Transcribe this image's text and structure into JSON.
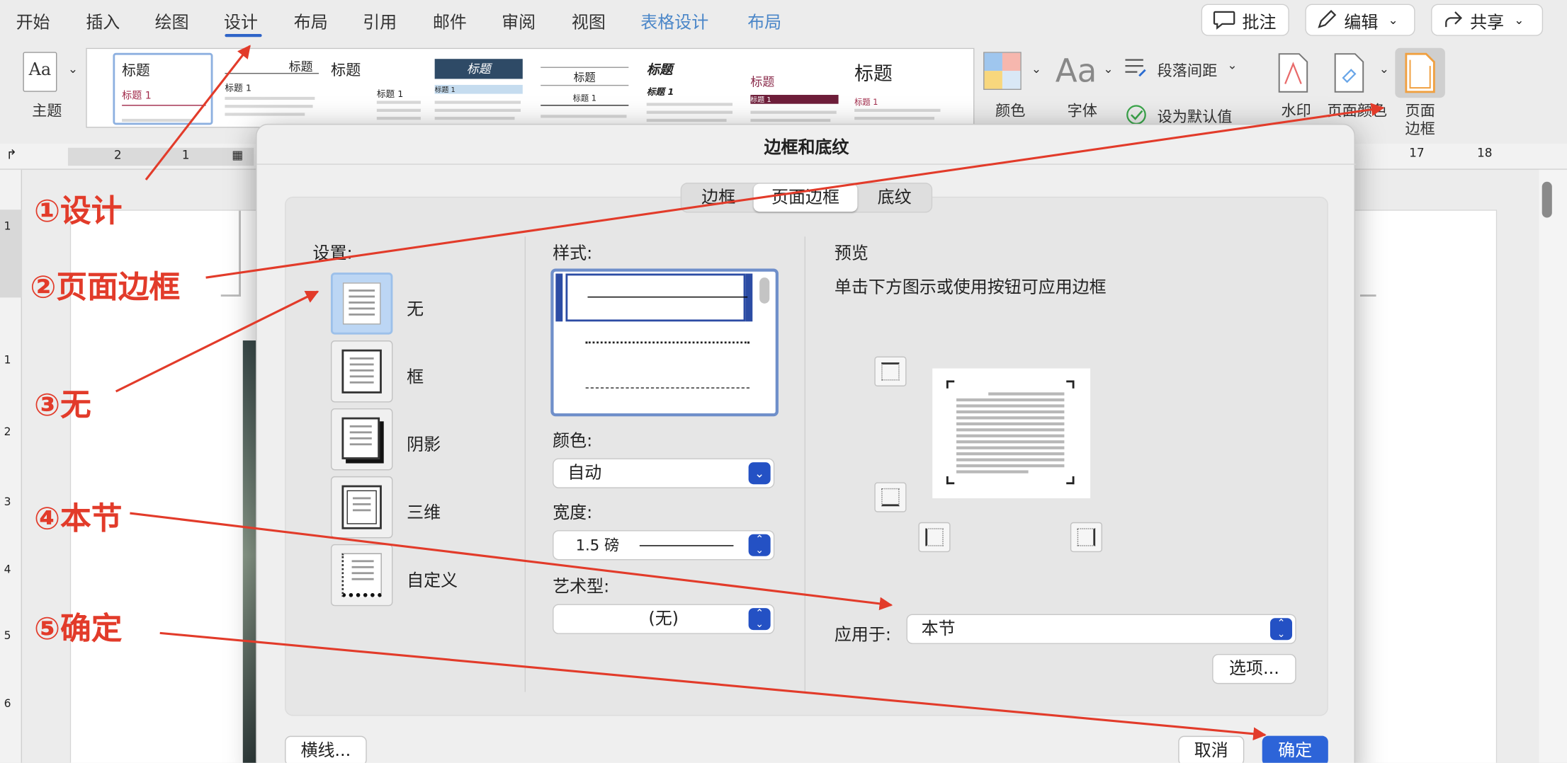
{
  "menubar": {
    "items": [
      "开始",
      "插入",
      "绘图",
      "设计",
      "布局",
      "引用",
      "邮件",
      "审阅",
      "视图",
      "表格设计",
      "布局"
    ],
    "comment_label": "批注",
    "edit_label": "编辑",
    "share_label": "共享"
  },
  "ribbon": {
    "theme_icon_text": "Aa",
    "theme_label": "主题",
    "gallery": [
      {
        "title": "标题",
        "subtitle": "标题 1"
      },
      {
        "title": "标题",
        "subtitle": "标题 1"
      },
      {
        "title": "标题",
        "subtitle": "标题 1"
      },
      {
        "title": "标题",
        "subtitle": "标题 1"
      },
      {
        "title": "标题",
        "subtitle": "标题 1"
      },
      {
        "title": "标题",
        "subtitle": "标题 1"
      },
      {
        "title": "标题",
        "subtitle": "标题 1"
      },
      {
        "title": "标题",
        "subtitle": "标题 1"
      }
    ],
    "colors_label": "颜色",
    "fonts_icon_text": "Aa",
    "fonts_label": "字体",
    "spacing_label": "段落间距",
    "default_label": "设为默认值",
    "watermark_label": "水印",
    "page_color_label": "页面颜色",
    "page_border_label_1": "页面",
    "page_border_label_2": "边框"
  },
  "ruler": {
    "top_ticks": [
      "2",
      "1",
      "17",
      "18"
    ],
    "left_ticks": [
      "1",
      "1",
      "2",
      "3",
      "4",
      "5",
      "6"
    ]
  },
  "dialog": {
    "title": "边框和底纹",
    "tabs": [
      "边框",
      "页面边框",
      "底纹"
    ],
    "active_tab": "页面边框",
    "settings_label": "设置:",
    "settings": [
      "无",
      "框",
      "阴影",
      "三维",
      "自定义"
    ],
    "style_label": "样式:",
    "color_label": "颜色:",
    "color_value": "自动",
    "width_label": "宽度:",
    "width_value": "1.5 磅",
    "art_label": "艺术型:",
    "art_value": "(无)",
    "preview_label": "预览",
    "preview_desc": "单击下方图示或使用按钮可应用边框",
    "apply_label": "应用于:",
    "apply_value": "本节",
    "options_label": "选项...",
    "hline_label": "横线...",
    "cancel_label": "取消",
    "ok_label": "确定"
  },
  "annotations": {
    "step1": "①设计",
    "step2": "②页面边框",
    "step3": "③无",
    "step4": "④本节",
    "step5": "⑤确定"
  },
  "colors": {
    "annotation_red": "#e23b2a",
    "ok_blue": "#2d64d8",
    "menu_accent_blue": "#4a86c8"
  }
}
